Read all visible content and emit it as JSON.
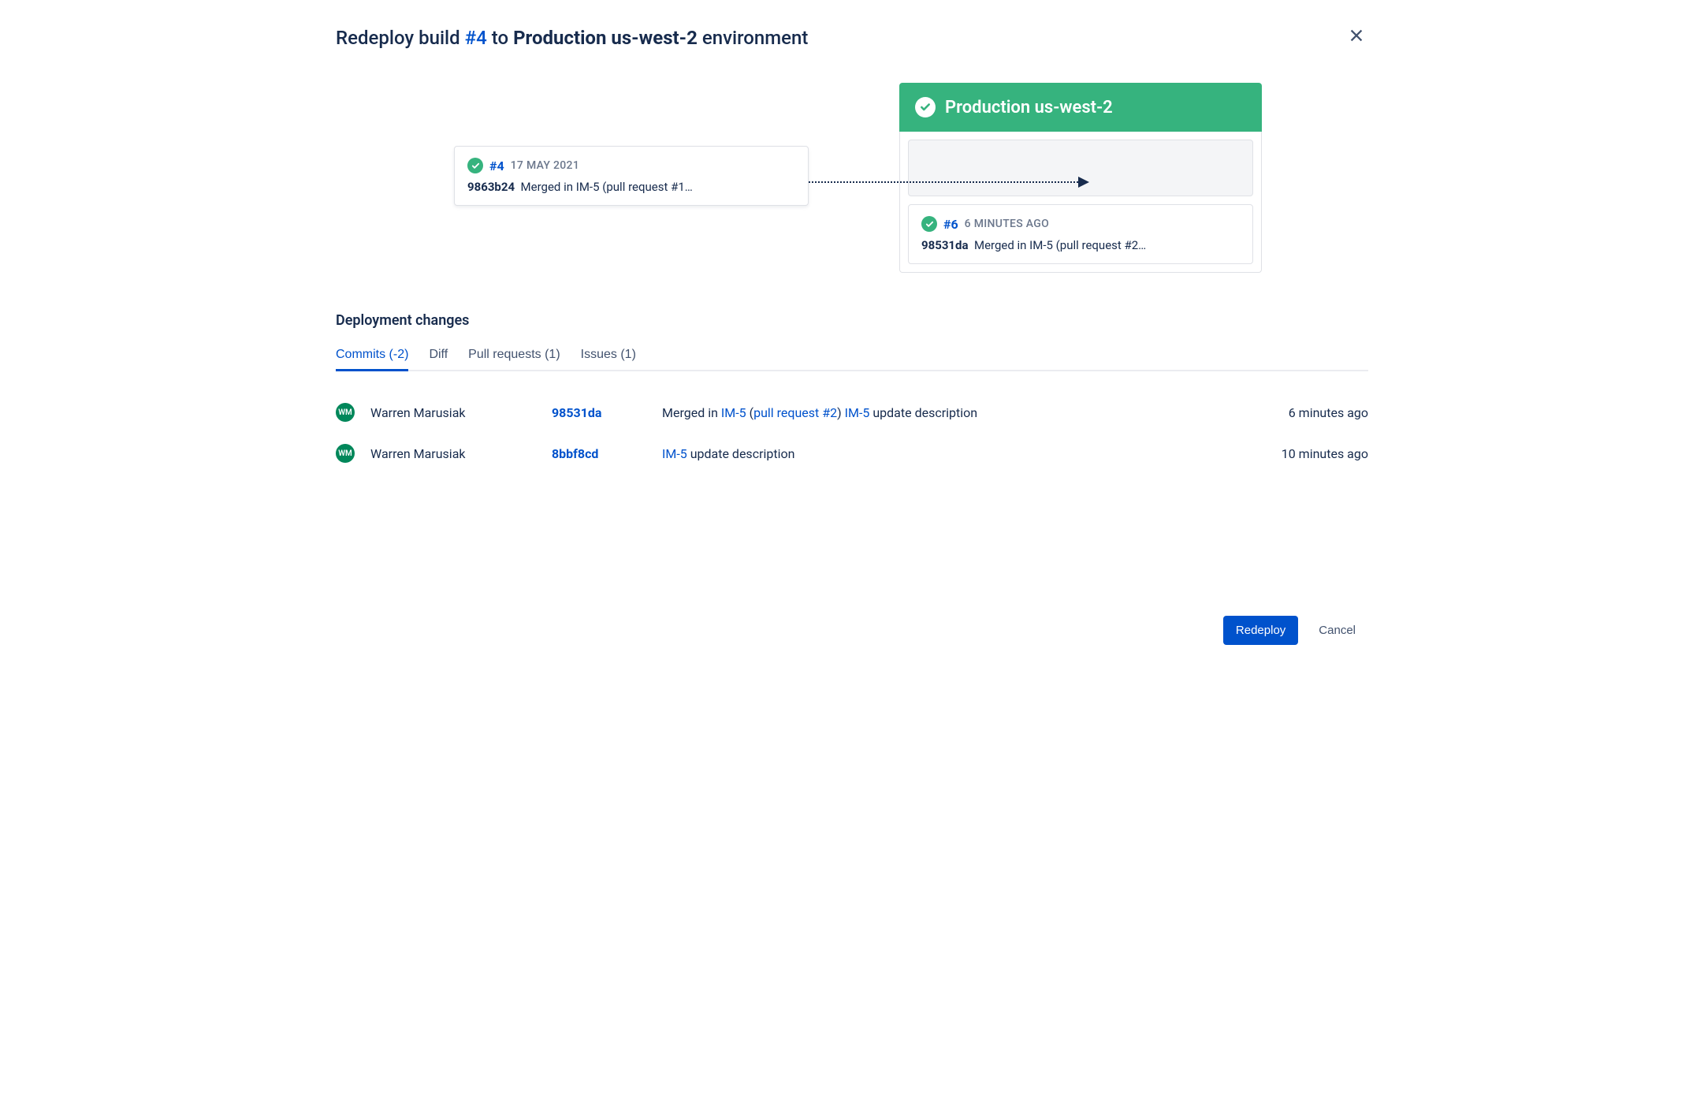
{
  "header": {
    "title_prefix": "Redeploy build ",
    "build_link": "#4",
    "title_mid": " to ",
    "env_name": "Production us-west-2",
    "title_suffix": " environment"
  },
  "source_build": {
    "number": "#4",
    "timestamp": "17 MAY 2021",
    "commit_hash": "9863b24",
    "commit_msg": "Merged in IM-5 (pull request #1…"
  },
  "target_env": {
    "name": "Production us-west-2",
    "current_build": {
      "number": "#6",
      "timestamp": "6 MINUTES AGO",
      "commit_hash": "98531da",
      "commit_msg": "Merged in IM-5 (pull request #2…"
    }
  },
  "changes_section_title": "Deployment changes",
  "tabs": {
    "commits": "Commits (-2)",
    "diff": "Diff",
    "prs": "Pull requests (1)",
    "issues": "Issues (1)"
  },
  "commits": [
    {
      "author_initials": "WM",
      "author": "Warren Marusiak",
      "hash": "98531da",
      "msg_prefix": "Merged in ",
      "msg_link1": "IM-5",
      "msg_mid1": " (",
      "msg_link2": "pull request #2",
      "msg_mid2": ") ",
      "msg_link3": "IM-5",
      "msg_suffix": " update description",
      "time": "6 minutes ago"
    },
    {
      "author_initials": "WM",
      "author": "Warren Marusiak",
      "hash": "8bbf8cd",
      "msg_prefix": "",
      "msg_link1": "IM-5",
      "msg_mid1": "",
      "msg_link2": "",
      "msg_mid2": "",
      "msg_link3": "",
      "msg_suffix": " update description",
      "time": "10 minutes ago"
    }
  ],
  "footer": {
    "redeploy": "Redeploy",
    "cancel": "Cancel"
  }
}
